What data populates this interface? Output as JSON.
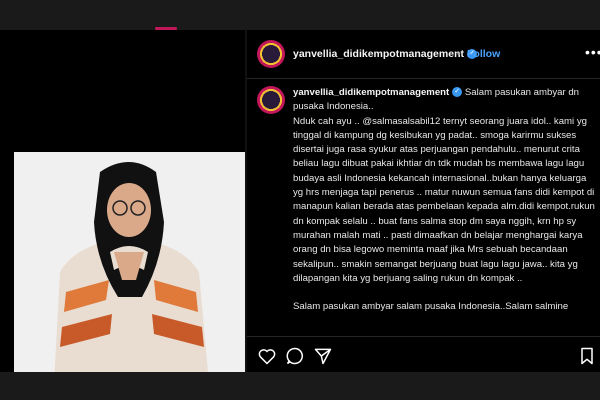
{
  "post": {
    "username": "yanvellia_didikempotmanagement",
    "follow_separator": "•",
    "follow_label": "Follow",
    "more_icon": "•••",
    "caption_lines": [
      "Salam pasukan ambyar dn pusaka Indonesia..",
      "Nduk cah ayu .. @salmasalsabil12 ternyt seorang juara idol.. kami yg tinggal di kampung dg kesibukan yg padat.. smoga karirmu sukses disertai juga rasa syukur atas perjuangan pendahulu.. menurut crita beliau lagu dibuat pakai ikhtiar dn tdk mudah bs membawa lagu lagu budaya asli Indonesia kekancah internasional..bukan hanya keluarga yg hrs menjaga tapi penerus .. matur nuwun semua fans didi kempot di manapun kalian berada atas pembelaan kepada alm.didi kempot.rukun dn kompak selalu .. buat fans salma stop dm saya nggih, krn hp sy murahan malah mati .. pasti dimaafkan dn belajar menghargai karya orang dn bisa legowo meminta maaf jika Mrs sebuah becandaan sekalipun.. smakin semangat berjuang buat lagu lagu jawa.. kita yg dilapangan kita yg berjuang saling rukun dn kompak ..",
      "Salam pasukan ambyar salam pusaka Indonesia..Salam salmine"
    ]
  },
  "icons": [
    "avatar",
    "verified-badge-icon",
    "more-icon",
    "heart-icon",
    "comment-icon",
    "share-icon",
    "bookmark-icon"
  ],
  "colors": {
    "background": "#000000",
    "accent": "#4aa3ff",
    "verified": "#3897f0",
    "text": "#e8e8e8"
  }
}
